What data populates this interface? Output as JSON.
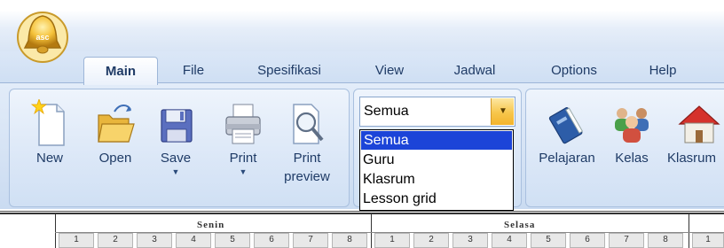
{
  "app_orb": {
    "logo_text": "asc"
  },
  "tabs": [
    "Main",
    "File",
    "Spesifikasi",
    "View",
    "Jadwal",
    "Options",
    "Help"
  ],
  "active_tab": "Main",
  "ribbon": {
    "new_label": "New",
    "open_label": "Open",
    "save_label": "Save",
    "print_label": "Print",
    "print_preview_line1": "Print",
    "print_preview_line2": "preview",
    "filter_combo": {
      "value": "Semua",
      "options": [
        "Semua",
        "Guru",
        "Klasrum",
        "Lesson grid"
      ],
      "selected": "Semua"
    },
    "pelajaran_label": "Pelajaran",
    "kelas_label": "Kelas",
    "klasrum_label": "Klasrum"
  },
  "timetable": {
    "days": [
      "Senin",
      "Selasa"
    ],
    "periods": [
      "1",
      "2",
      "3",
      "4",
      "5",
      "6",
      "7",
      "8"
    ],
    "next_period_partial": "1"
  },
  "colors": {
    "accent_selection": "#1c44d8",
    "ribbon_blue": "#d4e2f4",
    "combo_arrow": "#f7c64b"
  }
}
